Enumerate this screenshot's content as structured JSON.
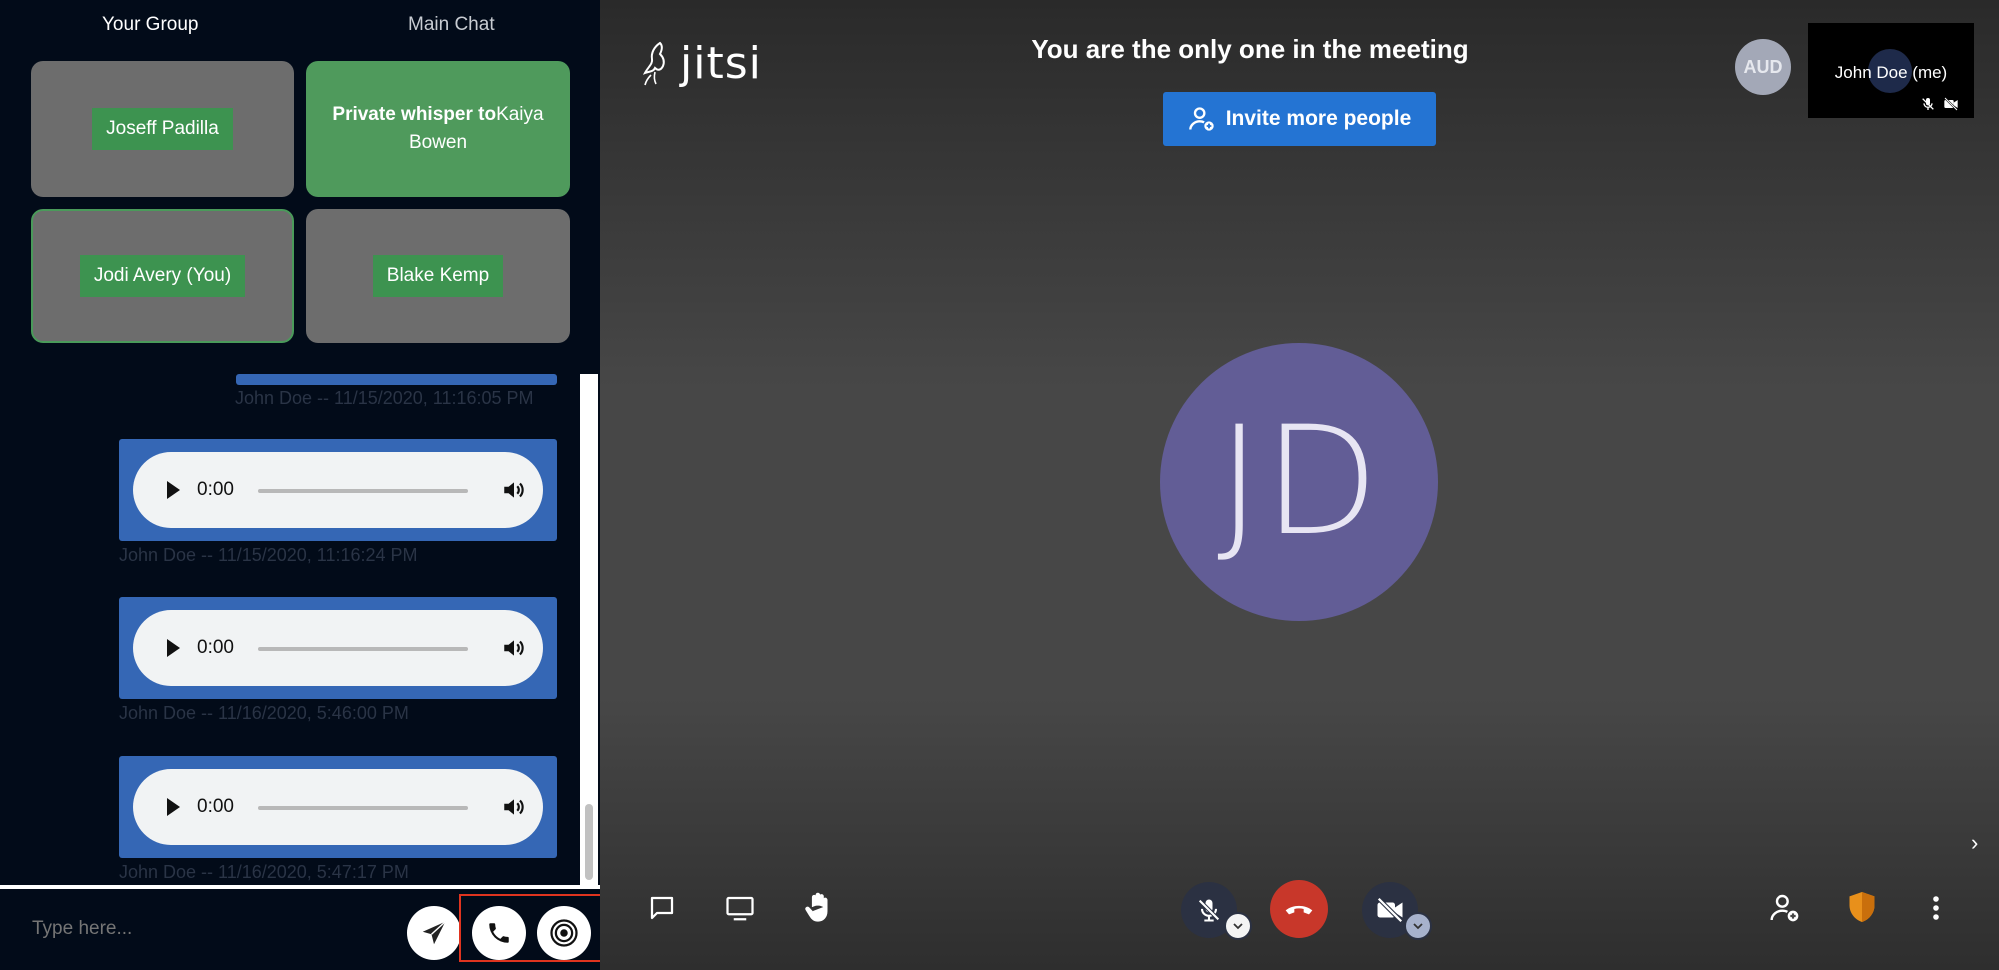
{
  "tabs": {
    "your_group": "Your Group",
    "main_chat": "Main Chat"
  },
  "group": {
    "tiles": [
      {
        "name": "Joseff Padilla"
      },
      {
        "whisper_prefix": "Private whisper to",
        "whisper_name": "Kaiya Bowen"
      },
      {
        "name": "Jodi Avery (You)"
      },
      {
        "name": "Blake Kemp"
      }
    ]
  },
  "chat": {
    "messages": [
      {
        "meta": "John Doe -- 11/15/2020, 11:16:05 PM"
      },
      {
        "time": "0:00",
        "meta": "John Doe -- 11/15/2020, 11:16:24 PM"
      },
      {
        "time": "0:00",
        "meta": "John Doe -- 11/16/2020, 5:46:00 PM"
      },
      {
        "time": "0:00",
        "meta": "John Doe -- 11/16/2020, 5:47:17 PM"
      }
    ],
    "input_placeholder": "Type here..."
  },
  "meeting": {
    "logo": "jitsi",
    "status": "You are the only one in the meeting",
    "invite_label": "Invite more people",
    "aud_badge": "AUD",
    "self_name": "John Doe (me)",
    "avatar_initials": "JD"
  },
  "colors": {
    "accent_blue": "#2474d3",
    "hangup_red": "#c8372a",
    "whisper_green": "#4f9a5c",
    "avatar_purple": "#625d96"
  },
  "icons": [
    "send-icon",
    "phone-icon",
    "record-icon",
    "chat-icon",
    "screenshare-icon",
    "raise-hand-icon",
    "mic-muted-icon",
    "hangup-icon",
    "camera-off-icon",
    "invite-person-icon",
    "security-shield-icon",
    "more-options-icon",
    "chevron-right-icon"
  ]
}
